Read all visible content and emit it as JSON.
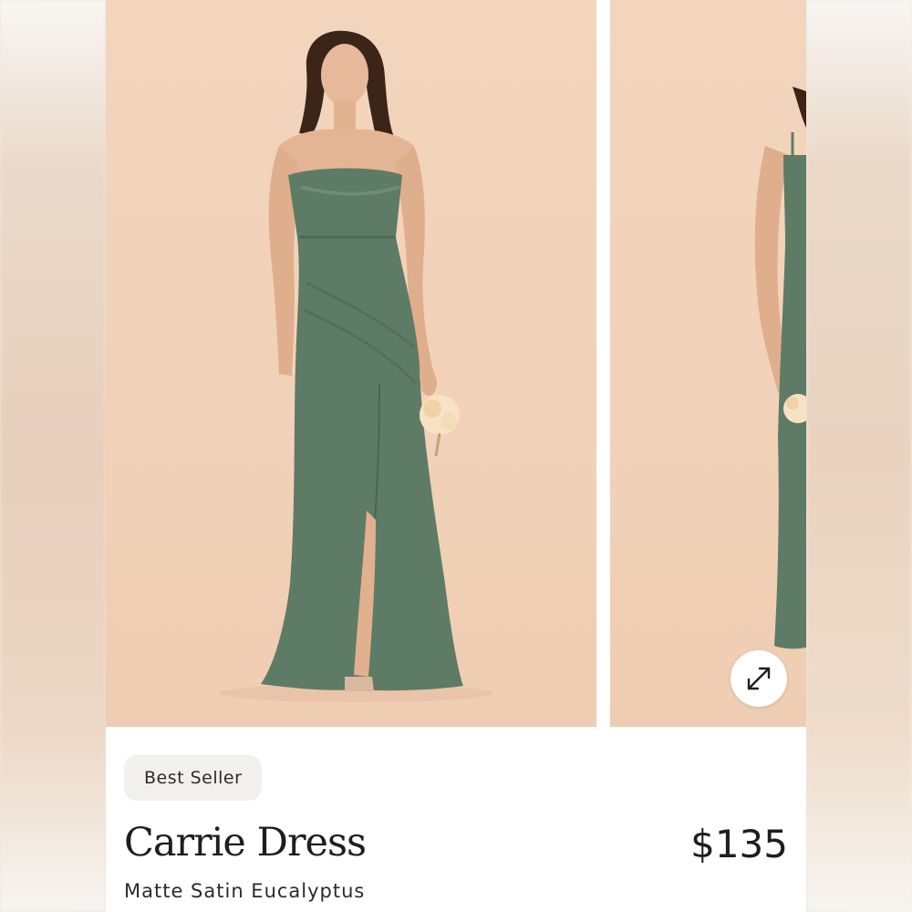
{
  "product": {
    "badge": "Best Seller",
    "name": "Carrie Dress",
    "price": "$135",
    "variant": "Matte Satin Eucalyptus"
  },
  "gallery": {
    "expand_icon": "expand-arrows-icon"
  },
  "colors": {
    "background_peach": "#f1d2b8",
    "dress_green": "#5e7b66",
    "badge_bg": "#f1f0ee",
    "text_dark": "#1e1e1e"
  }
}
